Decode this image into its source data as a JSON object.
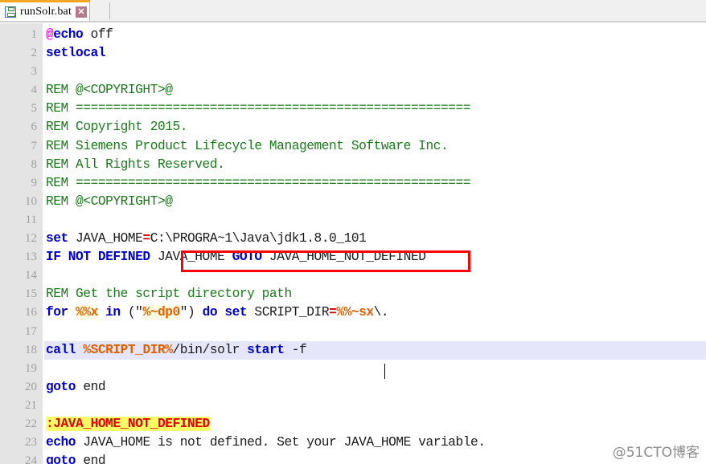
{
  "window": {
    "app": "text-editor",
    "accent_color": "#f5a623",
    "background": "#ffffff"
  },
  "tabbar": {
    "tabs": [
      {
        "label": "runSolr.bat",
        "icon": "floppy-disk-save-icon",
        "close_label": "✕",
        "active": true
      }
    ]
  },
  "editor": {
    "gutter_color": "#e4e4e4",
    "line_number_color": "#a0a0a0",
    "current_line": 18,
    "current_line_highlight": "#e6e6fa",
    "caret_after": "-f",
    "colors": {
      "keyword": "#0000cc",
      "comment": "#1a7a1a",
      "at_sign": "#ff00ff",
      "variable": "#e06000",
      "label": "#e00000",
      "label_highlight": "#ffff66",
      "operator": "#cc0000",
      "plain": "#1a1a1a"
    },
    "lines": [
      {
        "n": "1",
        "tokens": [
          {
            "t": "@",
            "c": "at"
          },
          {
            "t": "echo",
            "c": "kw"
          },
          {
            "t": " off",
            "c": "plain"
          }
        ]
      },
      {
        "n": "2",
        "tokens": [
          {
            "t": "setlocal",
            "c": "kw"
          }
        ]
      },
      {
        "n": "3",
        "tokens": []
      },
      {
        "n": "4",
        "tokens": [
          {
            "t": "REM @<COPYRIGHT>@",
            "c": "rem"
          }
        ]
      },
      {
        "n": "5",
        "tokens": [
          {
            "t": "REM =====================================================",
            "c": "rem"
          }
        ]
      },
      {
        "n": "6",
        "tokens": [
          {
            "t": "REM Copyright 2015.",
            "c": "rem"
          }
        ]
      },
      {
        "n": "7",
        "tokens": [
          {
            "t": "REM Siemens Product Lifecycle Management Software Inc.",
            "c": "rem"
          }
        ]
      },
      {
        "n": "8",
        "tokens": [
          {
            "t": "REM All Rights Reserved.",
            "c": "rem"
          }
        ]
      },
      {
        "n": "9",
        "tokens": [
          {
            "t": "REM =====================================================",
            "c": "rem"
          }
        ]
      },
      {
        "n": "10",
        "tokens": [
          {
            "t": "REM @<COPYRIGHT>@",
            "c": "rem"
          }
        ]
      },
      {
        "n": "11",
        "tokens": []
      },
      {
        "n": "12",
        "tokens": [
          {
            "t": "set",
            "c": "kw"
          },
          {
            "t": " JAVA_HOME",
            "c": "plain"
          },
          {
            "t": "=",
            "c": "op"
          },
          {
            "t": "C:\\PROGRA~1\\Java\\jdk1.8.0_101",
            "c": "plain"
          }
        ]
      },
      {
        "n": "13",
        "tokens": [
          {
            "t": "IF NOT DEFINED",
            "c": "kw"
          },
          {
            "t": " JAVA_HOME ",
            "c": "plain"
          },
          {
            "t": "GOTO",
            "c": "kw"
          },
          {
            "t": " JAVA_HOME_NOT_DEFINED",
            "c": "plain"
          }
        ]
      },
      {
        "n": "14",
        "tokens": []
      },
      {
        "n": "15",
        "tokens": [
          {
            "t": "REM Get the script directory path",
            "c": "rem"
          }
        ]
      },
      {
        "n": "16",
        "tokens": [
          {
            "t": "for",
            "c": "kw"
          },
          {
            "t": " ",
            "c": "plain"
          },
          {
            "t": "%%x",
            "c": "varhl"
          },
          {
            "t": " ",
            "c": "plain"
          },
          {
            "t": "in",
            "c": "kw"
          },
          {
            "t": " (\"",
            "c": "plain"
          },
          {
            "t": "%~dp0",
            "c": "varhl"
          },
          {
            "t": "\") ",
            "c": "plain"
          },
          {
            "t": "do set",
            "c": "kw"
          },
          {
            "t": " SCRIPT_DIR",
            "c": "plain"
          },
          {
            "t": "=",
            "c": "op"
          },
          {
            "t": "%%~sx",
            "c": "var"
          },
          {
            "t": "\\.",
            "c": "plain"
          }
        ]
      },
      {
        "n": "17",
        "tokens": []
      },
      {
        "n": "18",
        "tokens": [
          {
            "t": "call",
            "c": "kw"
          },
          {
            "t": " ",
            "c": "plain"
          },
          {
            "t": "%SCRIPT_DIR%",
            "c": "var"
          },
          {
            "t": "/bin/solr ",
            "c": "plain"
          },
          {
            "t": "start",
            "c": "kw"
          },
          {
            "t": " -f",
            "c": "plain"
          }
        ]
      },
      {
        "n": "19",
        "tokens": []
      },
      {
        "n": "20",
        "tokens": [
          {
            "t": "goto",
            "c": "kw"
          },
          {
            "t": " end",
            "c": "plain"
          }
        ]
      },
      {
        "n": "21",
        "tokens": []
      },
      {
        "n": "22",
        "tokens": [
          {
            "t": ":JAVA_HOME_NOT_DEFINED",
            "c": "lbl"
          }
        ]
      },
      {
        "n": "23",
        "tokens": [
          {
            "t": "echo",
            "c": "kw"
          },
          {
            "t": " JAVA_HOME is not defined. Set your JAVA_HOME variable.",
            "c": "plain"
          }
        ]
      },
      {
        "n": "24",
        "tokens": [
          {
            "t": "goto",
            "c": "kw"
          },
          {
            "t": " end",
            "c": "plain"
          }
        ]
      }
    ]
  },
  "annotation": {
    "type": "red-rectangle",
    "color": "#ff0000",
    "targets_text": "C:\\PROGRA~1\\Java\\jdk1.8.0_101"
  },
  "watermark": {
    "text": "@51CTO博客",
    "color": "#8c8c8c"
  }
}
